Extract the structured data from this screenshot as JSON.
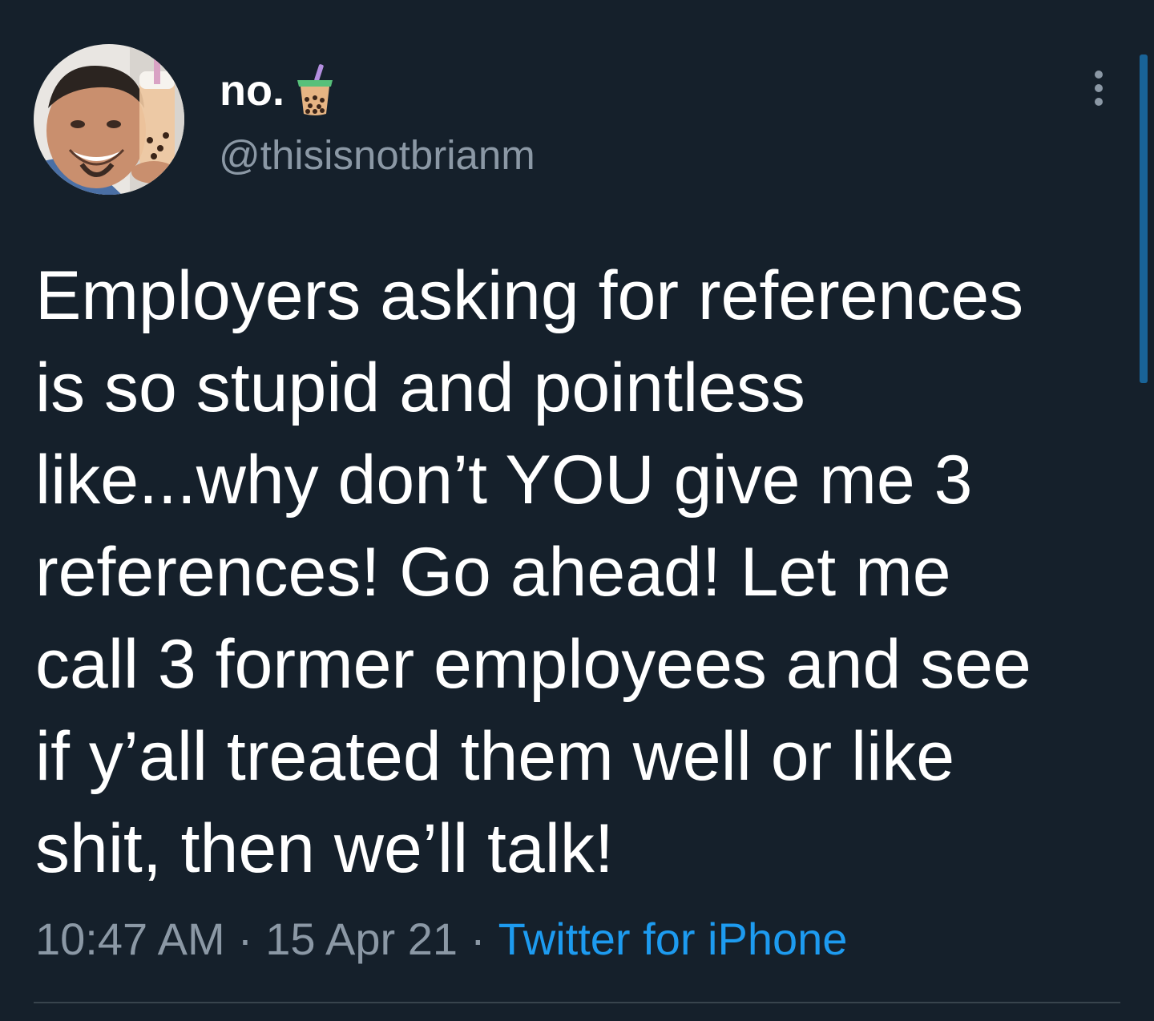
{
  "author": {
    "display_name": "no.",
    "display_name_emoji": "bubble-tea-emoji",
    "handle": "@thisisnotbrianm",
    "avatar_icon": "user-avatar-photo"
  },
  "tweet": {
    "lines": [
      "Employers asking for references",
      "is so stupid and pointless",
      "like...why don’t YOU give me 3",
      "references! Go ahead! Let me",
      "call 3 former employees and see",
      "if y’all treated them well or like",
      "shit, then we’ll talk!"
    ],
    "time": "10:47 AM",
    "separator": "·",
    "date": "15 Apr 21",
    "source": "Twitter for iPhone"
  },
  "icons": {
    "more": "more-vertical-icon"
  },
  "colors": {
    "background": "#15202b",
    "text": "#ffffff",
    "secondary_text": "#8b98a5",
    "accent": "#1d9bf0",
    "divider": "#38444d"
  }
}
